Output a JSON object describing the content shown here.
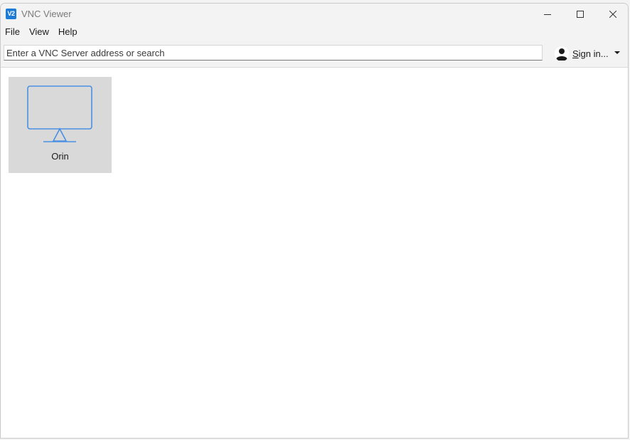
{
  "window": {
    "title": "VNC Viewer",
    "logo_text": "V2",
    "logo_color": "#1e7bd6",
    "controls": [
      "minimize-icon",
      "maximize-icon",
      "close-icon"
    ]
  },
  "menubar": {
    "items": [
      {
        "label": "File"
      },
      {
        "label": "View"
      },
      {
        "label": "Help"
      }
    ]
  },
  "toolbar": {
    "search": {
      "value": "",
      "placeholder": "Enter a VNC Server address or search"
    },
    "signin": {
      "label_underlined": "S",
      "label_rest": "ign in...",
      "icon": "user-avatar-icon",
      "menu_icon": "dropdown-arrow-icon"
    }
  },
  "address_book": {
    "entries": [
      {
        "name": "Orin",
        "icon": "monitor-icon",
        "icon_color": "#4a90e2",
        "selected": true
      }
    ]
  }
}
